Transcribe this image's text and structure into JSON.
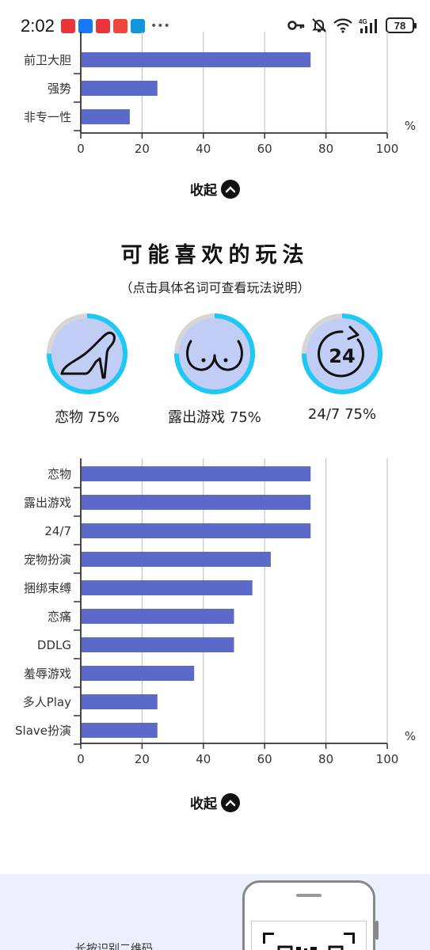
{
  "status_bar": {
    "time": "2:02",
    "battery": "78",
    "app_icon_colors": [
      "#e8363a",
      "#1677ff",
      "#e8363a",
      "#f0453a",
      "#1296db"
    ],
    "icons": [
      "key-icon",
      "mute-icon",
      "wifi-icon",
      "signal-4g-icon",
      "battery-icon"
    ],
    "network": "4G"
  },
  "charts": [
    {
      "chart_data": {
        "type": "bar",
        "orientation": "horizontal",
        "categories": [
          "前卫大胆",
          "强势",
          "非专一性"
        ],
        "values": [
          75,
          25,
          16
        ],
        "xlim": [
          0,
          100
        ],
        "xticks": [
          0,
          20,
          40,
          60,
          80,
          100
        ],
        "unit": "%",
        "grid": true,
        "bar_color": "#5b6ac8"
      }
    },
    {
      "chart_data": {
        "type": "bar",
        "orientation": "horizontal",
        "categories": [
          "恋物",
          "露出游戏",
          "24/7",
          "宠物扮演",
          "捆绑束缚",
          "恋痛",
          "DDLG",
          "羞辱游戏",
          "多人Play",
          "Slave扮演"
        ],
        "values": [
          75,
          75,
          75,
          62,
          56,
          50,
          50,
          37,
          25,
          25
        ],
        "xlim": [
          0,
          100
        ],
        "xticks": [
          0,
          20,
          40,
          60,
          80,
          100
        ],
        "unit": "%",
        "grid": true,
        "bar_color": "#5b6ac8"
      }
    }
  ],
  "collapse_label": "收起",
  "section": {
    "title": "可能喜欢的玩法",
    "subtitle": "（点击具体名词可查看玩法说明）"
  },
  "plays": [
    {
      "label": "恋物 75%",
      "percent": 75,
      "icon": "high-heel-icon"
    },
    {
      "label": "露出游戏 75%",
      "percent": 75,
      "icon": "chest-icon"
    },
    {
      "label": "24/7 75%",
      "percent": 75,
      "icon": "clock-24-icon"
    }
  ],
  "colors": {
    "accent_ring": "#1ec8f5",
    "ring_track": "#d6d6d6",
    "ring_fill": "#c1cdf5",
    "banner_bg": "#eceffc"
  },
  "banner": {
    "text": "长按识别二维码"
  }
}
